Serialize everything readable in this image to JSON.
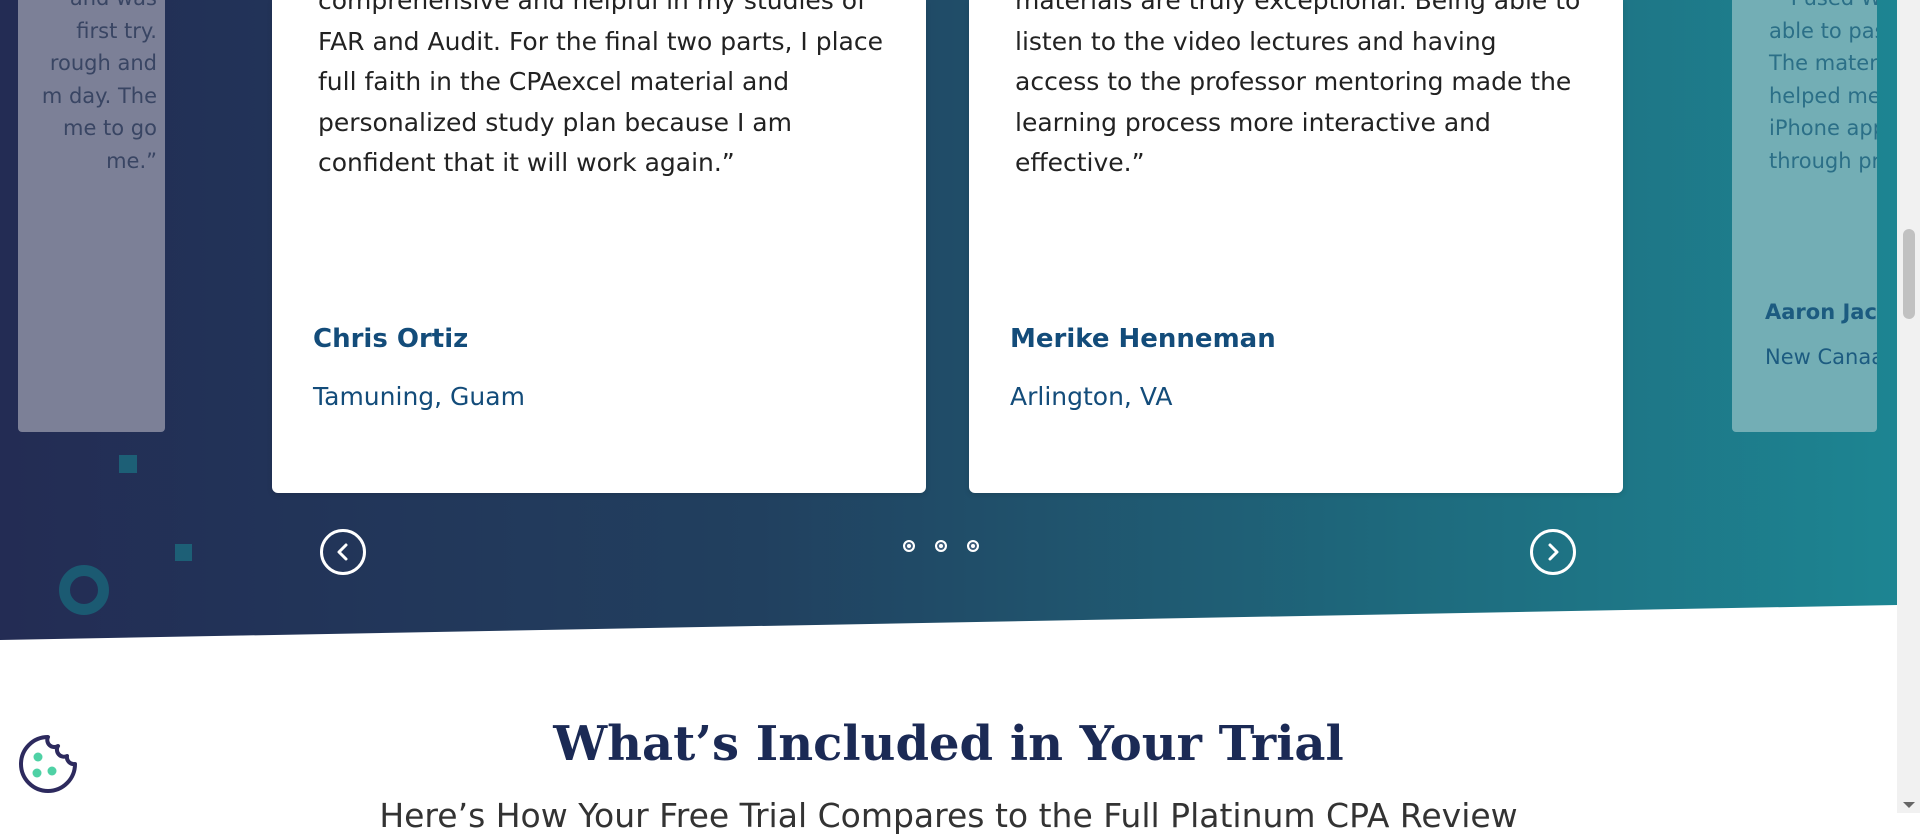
{
  "testimonials": {
    "left_partial": {
      "quote": "and was\nfirst try.\nrough and\nm day. The\nme to go\nme.”"
    },
    "cards": [
      {
        "quote": "comprehensive and helpful in my studies of FAR and Audit. For the final two parts, I place full faith in the CPAexcel material and personalized study plan because I am confident that it will work again.”",
        "name": "Chris Ortiz",
        "location": "Tamuning, Guam"
      },
      {
        "quote": "materials are truly exceptional. Being able to listen to the video lectures and having access to the professor mentoring made the learning process more interactive and effective.”",
        "name": "Merike Henneman",
        "location": "Arlington, VA"
      }
    ],
    "right_partial": {
      "quote": "““I used Wi\nable to pas\nThe materia\nhelped me\niPhone app\nthrough pra",
      "name": "Aaron Jaco",
      "location": "New Canaar"
    },
    "pagination": {
      "count": 3,
      "active_index": 1
    }
  },
  "icons": {
    "prev": "chevron-left-circle-icon",
    "next": "chevron-right-circle-icon",
    "cookie": "cookie-icon"
  },
  "section": {
    "title": "What’s Included in Your Trial",
    "subtitle": "Here’s How Your Free Trial Compares to the Full Platinum CPA Review"
  },
  "colors": {
    "hero_gradient_start": "#232c54",
    "hero_gradient_end": "#1d8592",
    "name_color": "#134c7a",
    "title_color": "#1b2a55",
    "cookie_accent": "#4fd1a5"
  }
}
